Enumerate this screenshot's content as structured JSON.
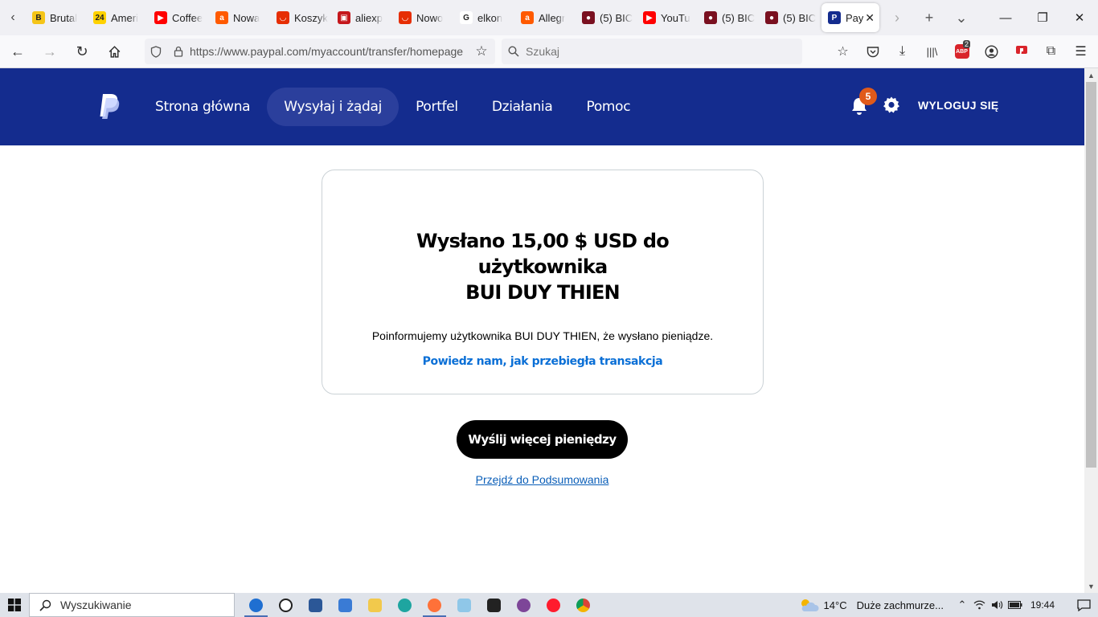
{
  "browser": {
    "tabs": [
      {
        "label": "Brutal",
        "fav_color": "#f5c518",
        "fav_text": "B"
      },
      {
        "label": "Ameri",
        "fav_color": "#ffd200",
        "fav_text": "24"
      },
      {
        "label": "Coffee",
        "fav_color": "#ff0000",
        "fav_text": "▶"
      },
      {
        "label": "Nowa",
        "fav_color": "#ff5a00",
        "fav_text": "a"
      },
      {
        "label": "Koszyk",
        "fav_color": "#e62e04",
        "fav_text": "◡"
      },
      {
        "label": "aliexp",
        "fav_color": "#c5171c",
        "fav_text": "▣"
      },
      {
        "label": "Nowo",
        "fav_color": "#e62e04",
        "fav_text": "◡"
      },
      {
        "label": "elkon",
        "fav_color": "#ffffff",
        "fav_text": "G"
      },
      {
        "label": "Allegr",
        "fav_color": "#ff5a00",
        "fav_text": "a"
      },
      {
        "label": "(5) BIC",
        "fav_color": "#7a1020",
        "fav_text": "●"
      },
      {
        "label": "YouTu",
        "fav_color": "#ff0000",
        "fav_text": "▶"
      },
      {
        "label": "(5) BIC",
        "fav_color": "#7a1020",
        "fav_text": "●"
      },
      {
        "label": "(5) BIC",
        "fav_color": "#7a1020",
        "fav_text": "●"
      }
    ],
    "active_tab": {
      "label": "Pay",
      "fav_color": "#142c8e",
      "fav_text": "P"
    },
    "url": "https://www.paypal.com/myaccount/transfer/homepage",
    "search_placeholder": "Szukaj",
    "abp_label": "ABP",
    "abp_count": "2"
  },
  "paypal": {
    "nav": [
      {
        "label": "Strona główna",
        "active": false
      },
      {
        "label": "Wysyłaj i żądaj",
        "active": true
      },
      {
        "label": "Portfel",
        "active": false
      },
      {
        "label": "Działania",
        "active": false
      },
      {
        "label": "Pomoc",
        "active": false
      }
    ],
    "notification_count": "5",
    "logout": "WYLOGUJ SIĘ",
    "brand_color": "#142c8e"
  },
  "confirmation": {
    "title_line1": "Wysłano 15,00 $ USD do użytkownika",
    "title_line2": "BUI DUY THIEN",
    "info": "Poinformujemy użytkownika BUI DUY THIEN, że wysłano pieniądze.",
    "feedback_link": "Powiedz nam, jak przebiegła transakcja",
    "send_more_button": "Wyślij więcej pieniędzy",
    "summary_link": "Przejdź do Podsumowania"
  },
  "taskbar": {
    "search_placeholder": "Wyszukiwanie",
    "temperature": "14°C",
    "weather": "Duże zachmurze...",
    "time": "19:44"
  }
}
